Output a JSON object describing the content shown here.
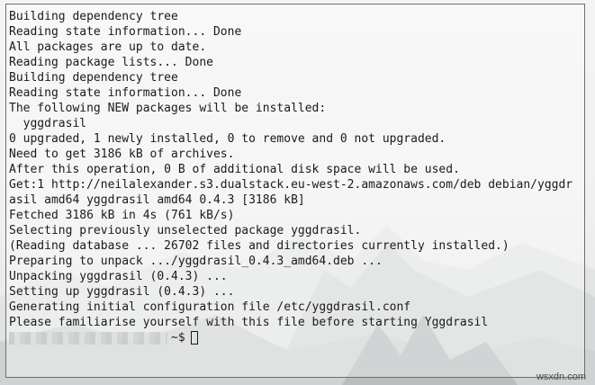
{
  "terminal": {
    "lines": [
      "Building dependency tree",
      "Reading state information... Done",
      "All packages are up to date.",
      "Reading package lists... Done",
      "Building dependency tree",
      "Reading state information... Done",
      "The following NEW packages will be installed:",
      "  yggdrasil",
      "0 upgraded, 1 newly installed, 0 to remove and 0 not upgraded.",
      "Need to get 3186 kB of archives.",
      "After this operation, 0 B of additional disk space will be used.",
      "Get:1 http://neilalexander.s3.dualstack.eu-west-2.amazonaws.com/deb debian/yggdr",
      "asil amd64 yggdrasil amd64 0.4.3 [3186 kB]",
      "Fetched 3186 kB in 4s (761 kB/s)",
      "Selecting previously unselected package yggdrasil.",
      "(Reading database ... 26702 files and directories currently installed.)",
      "Preparing to unpack .../yggdrasil_0.4.3_amd64.deb ...",
      "Unpacking yggdrasil (0.4.3) ...",
      "Setting up yggdrasil (0.4.3) ...",
      "Generating initial configuration file /etc/yggdrasil.conf",
      "Please familiarise yourself with this file before starting Yggdrasil"
    ],
    "prompt_suffix": "~$"
  },
  "watermark": "wsxdn.com",
  "colors": {
    "text": "#1a1a1a",
    "border": "#6e6e6e",
    "background": "#f2f2f2"
  }
}
